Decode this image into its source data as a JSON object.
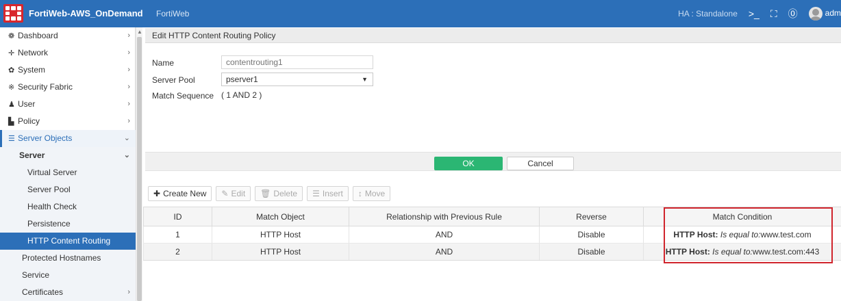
{
  "header": {
    "app_title": "FortiWeb-AWS_OnDemand",
    "app_subtitle": "FortiWeb",
    "ha_status": "HA : Standalone",
    "user": "adm"
  },
  "sidebar": {
    "items": [
      {
        "label": "Dashboard"
      },
      {
        "label": "Network"
      },
      {
        "label": "System"
      },
      {
        "label": "Security Fabric"
      },
      {
        "label": "User"
      },
      {
        "label": "Policy"
      },
      {
        "label": "Server Objects"
      },
      {
        "label": "Server"
      },
      {
        "label": "Virtual Server"
      },
      {
        "label": "Server Pool"
      },
      {
        "label": "Health Check"
      },
      {
        "label": "Persistence"
      },
      {
        "label": "HTTP Content Routing"
      },
      {
        "label": "Protected Hostnames"
      },
      {
        "label": "Service"
      },
      {
        "label": "Certificates"
      }
    ]
  },
  "panel": {
    "title": "Edit HTTP Content Routing Policy",
    "name_label": "Name",
    "name_placeholder": "contentrouting1",
    "server_pool_label": "Server Pool",
    "server_pool_value": "pserver1",
    "match_sequence_label": "Match Sequence",
    "match_sequence_value": "( 1 AND 2 )",
    "ok_label": "OK",
    "cancel_label": "Cancel"
  },
  "toolbar": {
    "create_new": "Create New",
    "edit": "Edit",
    "delete": "Delete",
    "insert": "Insert",
    "move": "Move"
  },
  "table": {
    "columns": [
      "ID",
      "Match Object",
      "Relationship with Previous Rule",
      "Reverse",
      "Match Condition"
    ],
    "rows": [
      {
        "id": "1",
        "match_object": "HTTP Host",
        "relationship": "AND",
        "reverse": "Disable",
        "cond_key": "HTTP Host:",
        "cond_op": "Is equal to:",
        "cond_value": "www.test.com"
      },
      {
        "id": "2",
        "match_object": "HTTP Host",
        "relationship": "AND",
        "reverse": "Disable",
        "cond_key": "HTTP Host:",
        "cond_op": "Is equal to:",
        "cond_value": "www.test.com:443"
      }
    ]
  },
  "colors": {
    "topbar": "#2c6fb8",
    "ok_button": "#2bb673",
    "highlight": "#d0242c"
  }
}
